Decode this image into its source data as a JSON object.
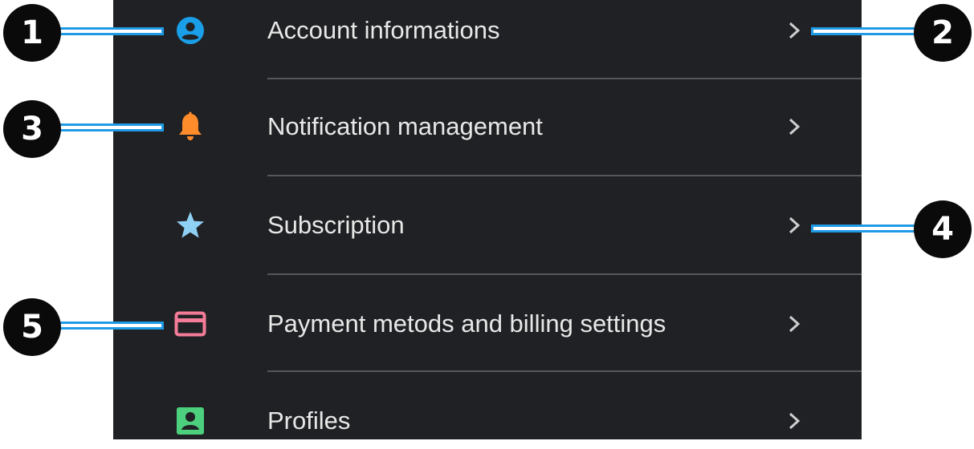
{
  "menu": {
    "items": [
      {
        "label": "Account informations",
        "icon": "account-circle-icon",
        "icon_color": "#1a9ee8"
      },
      {
        "label": "Notification management",
        "icon": "bell-icon",
        "icon_color": "#ff8c2a"
      },
      {
        "label": "Subscription",
        "icon": "star-icon",
        "icon_color": "#8fd0f5"
      },
      {
        "label": "Payment metods and billing settings",
        "icon": "credit-card-icon",
        "icon_color": "#f47c98"
      },
      {
        "label": "Profiles",
        "icon": "profile-card-icon",
        "icon_color": "#4cd07d"
      }
    ]
  },
  "callouts": [
    "1",
    "2",
    "3",
    "4",
    "5"
  ],
  "colors": {
    "panel_bg": "#202124",
    "text": "#e8e8e8",
    "divider": "#55575b",
    "callout_bg": "#0a0a0a",
    "leader_outline": "#1f9be6"
  }
}
